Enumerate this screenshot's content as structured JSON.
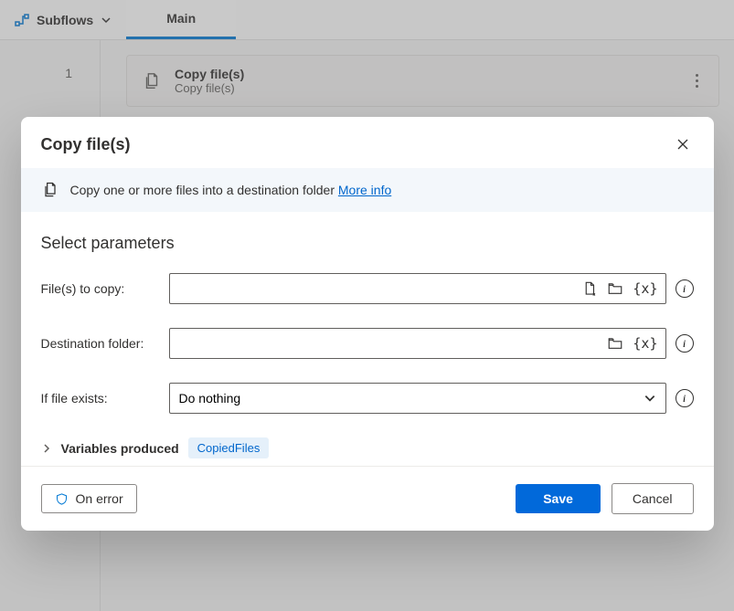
{
  "header": {
    "subflows_label": "Subflows",
    "tab_label": "Main"
  },
  "action": {
    "row_number": "1",
    "title": "Copy file(s)",
    "subtitle": "Copy file(s)"
  },
  "dialog": {
    "title": "Copy file(s)",
    "info_text": "Copy one or more files into a destination folder",
    "info_link": "More info",
    "section_title": "Select parameters",
    "fields": {
      "files_to_copy": {
        "label": "File(s) to copy:",
        "value": ""
      },
      "destination_folder": {
        "label": "Destination folder:",
        "value": ""
      },
      "if_file_exists": {
        "label": "If file exists:",
        "value": "Do nothing"
      }
    },
    "variables_produced": {
      "label": "Variables produced",
      "chip": "CopiedFiles"
    },
    "footer": {
      "on_error": "On error",
      "save": "Save",
      "cancel": "Cancel"
    }
  }
}
